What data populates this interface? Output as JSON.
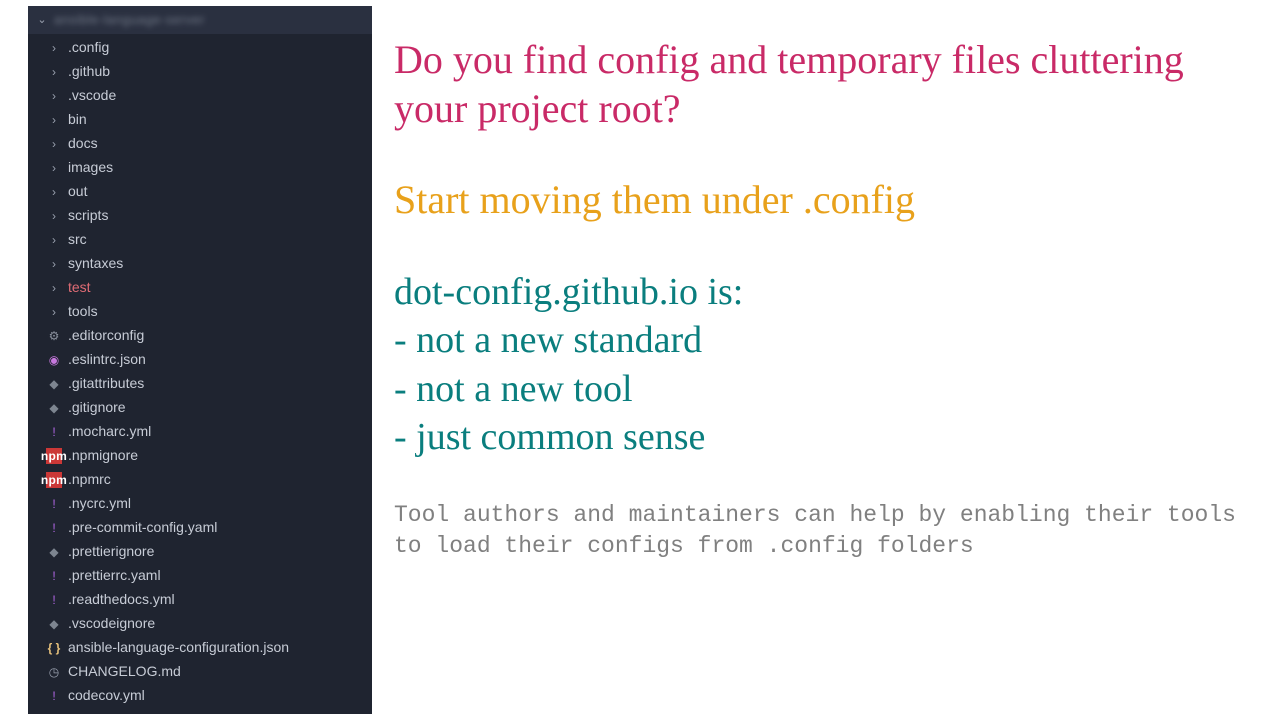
{
  "sidebar": {
    "project_name": "ansible-language-server",
    "items": [
      {
        "label": ".config",
        "kind": "folder",
        "icon": "chevron"
      },
      {
        "label": ".github",
        "kind": "folder",
        "icon": "chevron"
      },
      {
        "label": ".vscode",
        "kind": "folder",
        "icon": "chevron"
      },
      {
        "label": "bin",
        "kind": "folder",
        "icon": "chevron"
      },
      {
        "label": "docs",
        "kind": "folder",
        "icon": "chevron"
      },
      {
        "label": "images",
        "kind": "folder",
        "icon": "chevron"
      },
      {
        "label": "out",
        "kind": "folder",
        "icon": "chevron"
      },
      {
        "label": "scripts",
        "kind": "folder",
        "icon": "chevron"
      },
      {
        "label": "src",
        "kind": "folder",
        "icon": "chevron"
      },
      {
        "label": "syntaxes",
        "kind": "folder",
        "icon": "chevron"
      },
      {
        "label": "test",
        "kind": "folder",
        "icon": "chevron",
        "highlight": true
      },
      {
        "label": "tools",
        "kind": "folder",
        "icon": "chevron"
      },
      {
        "label": ".editorconfig",
        "kind": "file",
        "icon": "gear"
      },
      {
        "label": ".eslintrc.json",
        "kind": "file",
        "icon": "bullseye"
      },
      {
        "label": ".gitattributes",
        "kind": "file",
        "icon": "diamond"
      },
      {
        "label": ".gitignore",
        "kind": "file",
        "icon": "diamond"
      },
      {
        "label": ".mocharc.yml",
        "kind": "file",
        "icon": "bang"
      },
      {
        "label": ".npmignore",
        "kind": "file",
        "icon": "npm"
      },
      {
        "label": ".npmrc",
        "kind": "file",
        "icon": "npm"
      },
      {
        "label": ".nycrc.yml",
        "kind": "file",
        "icon": "bang"
      },
      {
        "label": ".pre-commit-config.yaml",
        "kind": "file",
        "icon": "bang"
      },
      {
        "label": ".prettierignore",
        "kind": "file",
        "icon": "diamond"
      },
      {
        "label": ".prettierrc.yaml",
        "kind": "file",
        "icon": "bang"
      },
      {
        "label": ".readthedocs.yml",
        "kind": "file",
        "icon": "bang"
      },
      {
        "label": ".vscodeignore",
        "kind": "file",
        "icon": "diamond"
      },
      {
        "label": "ansible-language-configuration.json",
        "kind": "file",
        "icon": "braces"
      },
      {
        "label": "CHANGELOG.md",
        "kind": "file",
        "icon": "clock"
      },
      {
        "label": "codecov.yml",
        "kind": "file",
        "icon": "bang"
      }
    ]
  },
  "content": {
    "headline": "Do you find config and temporary files cluttering your project root?",
    "subhead": "Start moving them under .config",
    "body_intro": "dot-config.github.io is:",
    "body_bullets": [
      "- not a new standard",
      "- not a new tool",
      "- just common sense"
    ],
    "footer": "Tool authors and maintainers can help by enabling their tools to load their configs from .config folders"
  },
  "icons": {
    "chevron": "›",
    "down": "⌄",
    "gear": "⚙",
    "bullseye": "◉",
    "diamond": "◆",
    "bang": "!",
    "npm": "npm",
    "braces": "{ }",
    "clock": "◷"
  }
}
